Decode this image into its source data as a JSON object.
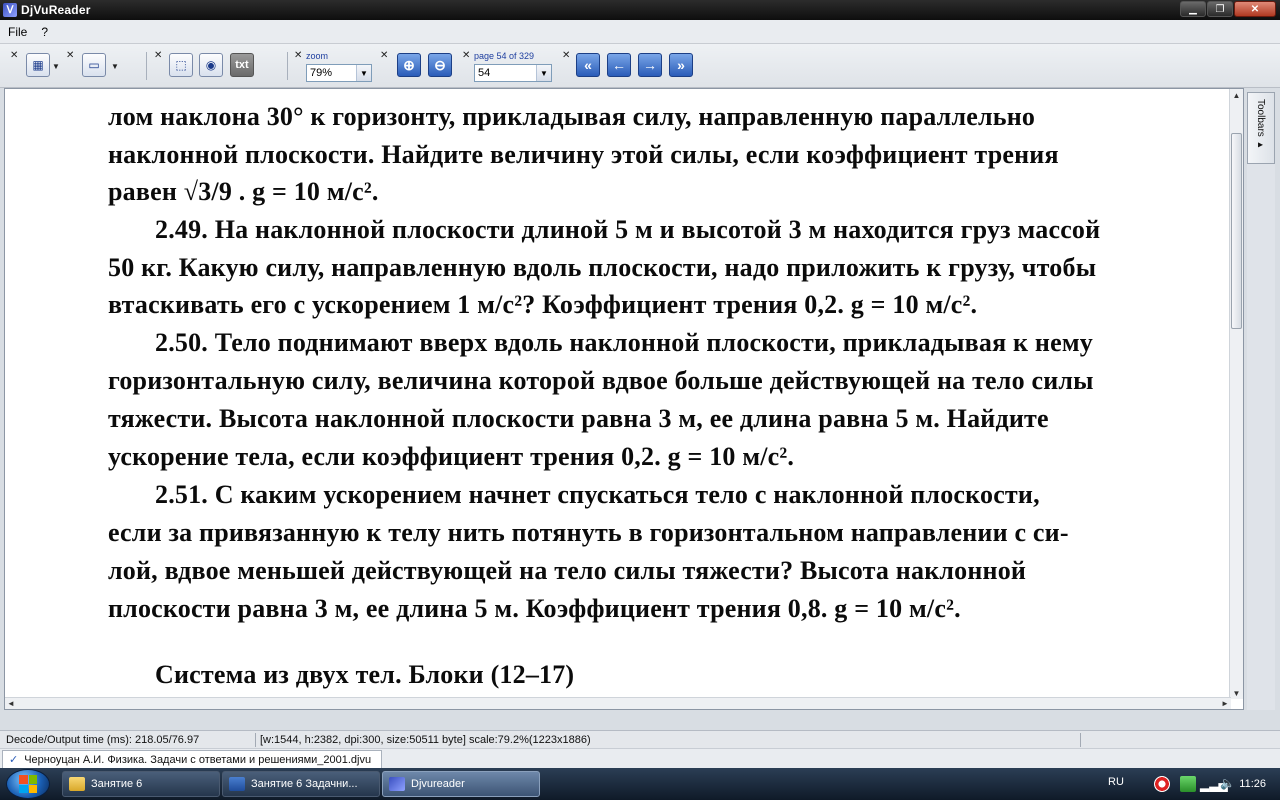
{
  "window": {
    "title": "DjVuReader"
  },
  "menu": [
    {
      "label": "File"
    },
    {
      "label": "?"
    }
  ],
  "toolbar": {
    "txt_label": "txt",
    "zoom_label": "zoom",
    "zoom_value": "79%",
    "page_label": "page 54 of 329",
    "page_value": "54"
  },
  "document": {
    "lines": [
      "лом наклона 30° к горизонту, прикладывая силу, направленную параллельно",
      "наклонной плоскости. Найдите величину этой силы, если коэффициент трения",
      "равен √3/9 . g = 10 м/с².",
      "2.49. На наклонной плоскости длиной 5 м и высотой 3 м находится груз массой",
      "50 кг. Какую силу, направленную вдоль плоскости, надо приложить к грузу, чтобы",
      "втаскивать его с ускорением 1 м/с²? Коэффициент трения 0,2. g = 10 м/с².",
      "2.50. Тело поднимают вверх вдоль наклонной плоскости, прикладывая к нему",
      "горизонтальную силу, величина которой вдвое больше действующей на тело силы",
      "тяжести. Высота наклонной плоскости равна 3 м, ее длина равна 5 м. Найдите",
      "ускорение тела, если коэффициент трения 0,2. g = 10 м/с².",
      "2.51. С каким ускорением начнет спускаться тело с наклонной плоскости,",
      "если за привязанную к телу нить потянуть в горизонтальном направлении с си-",
      "лой, вдвое меньшей действующей на тело силы тяжести? Высота наклонной",
      "плоскости равна 3 м, ее длина 5 м. Коэффициент трения 0,8. g = 10 м/с².",
      "Система из двух тел. Блоки (12–17)"
    ]
  },
  "side_tab": {
    "label": "Toolbars ▸"
  },
  "status": {
    "timing": "Decode/Output time (ms): 218.05/76.97",
    "info": "[w:1544, h:2382, dpi:300, size:50511 byte] scale:79.2%(1223x1886)"
  },
  "doc_tab": {
    "label": "Черноуцан А.И. Физика. Задачи с ответами и решениями_2001.djvu"
  },
  "taskbar": {
    "items": [
      {
        "label": "Занятие 6"
      },
      {
        "label": "Занятие 6 Задачни..."
      },
      {
        "label": "Djvureader"
      }
    ],
    "lang": "RU",
    "clock": "11:26"
  }
}
